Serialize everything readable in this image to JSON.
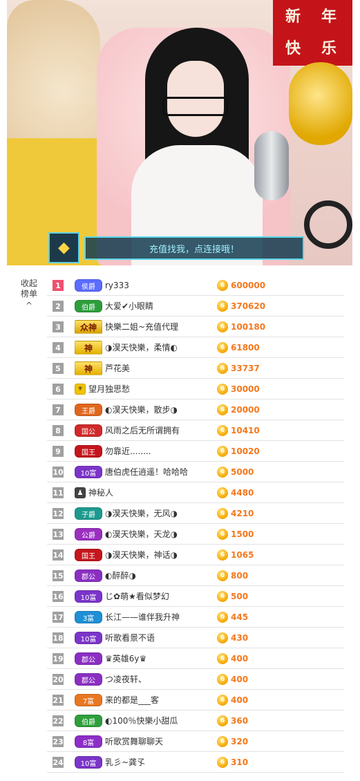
{
  "banner": {
    "gem_icon": "diamond-icon",
    "text": "充值找我，点连接哦！"
  },
  "stream_decor": {
    "red_sign": [
      "新",
      "年",
      "快",
      "乐"
    ]
  },
  "sidebar": {
    "line1": "收起",
    "line2": "榜单",
    "caret": "^"
  },
  "rankings": [
    {
      "rank": "1",
      "badge": "侯爵",
      "badge_color": "#5b6cff",
      "name": "ry333",
      "coin": "6",
      "amount": "600000",
      "rank_color": "#f0506e"
    },
    {
      "rank": "2",
      "badge": "伯爵",
      "badge_color": "#2e9e3c",
      "name": "大爱✔小眼睛",
      "coin": "6",
      "amount": "370620",
      "rank_color": "#a0a0a0"
    },
    {
      "rank": "3",
      "badge": "众神",
      "badge_color": "#d6a300",
      "name": "快樂二姐~充值代理",
      "coin": "6",
      "amount": "100180",
      "rank_color": "#a0a0a0",
      "god": true
    },
    {
      "rank": "4",
      "badge": "神",
      "badge_color": "#e2b100",
      "name": "◑淏天快樂，柔情◐",
      "coin": "6",
      "amount": "61800",
      "rank_color": "#a0a0a0",
      "god": true
    },
    {
      "rank": "5",
      "badge": "神",
      "badge_color": "#e2b100",
      "name": "芦花美",
      "coin": "6",
      "amount": "33737",
      "rank_color": "#a0a0a0",
      "god": true
    },
    {
      "rank": "6",
      "badge": "",
      "badge_color": "#f2c300",
      "name": "望月独思愁",
      "coin": "6",
      "amount": "30000",
      "rank_color": "#a0a0a0",
      "mini": true
    },
    {
      "rank": "7",
      "badge": "王爵",
      "badge_color": "#e0661d",
      "name": "◐淏天快樂，散步◑",
      "coin": "6",
      "amount": "20000",
      "rank_color": "#a0a0a0"
    },
    {
      "rank": "8",
      "badge": "国公",
      "badge_color": "#d02a2a",
      "name": "风雨之后无所谓拥有",
      "coin": "6",
      "amount": "10410",
      "rank_color": "#a0a0a0"
    },
    {
      "rank": "9",
      "badge": "国王",
      "badge_color": "#c4161c",
      "name": "勿靠近........",
      "coin": "6",
      "amount": "10020",
      "rank_color": "#a0a0a0"
    },
    {
      "rank": "10",
      "badge": "10富",
      "badge_color": "#7b35c9",
      "name": "唐伯虎任逍遥！哈哈哈",
      "coin": "6",
      "amount": "5000",
      "rank_color": "#a0a0a0"
    },
    {
      "rank": "11",
      "badge": "",
      "badge_color": "#444444",
      "name": "神秘人",
      "coin": "6",
      "amount": "4480",
      "rank_color": "#a0a0a0",
      "mystery": true
    },
    {
      "rank": "12",
      "badge": "子爵",
      "badge_color": "#1c9a8f",
      "name": "◑淏天快樂，无风◑",
      "coin": "6",
      "amount": "4210",
      "rank_color": "#a0a0a0"
    },
    {
      "rank": "13",
      "badge": "公爵",
      "badge_color": "#9a2fc0",
      "name": "◐淏天快樂，天龙◑",
      "coin": "6",
      "amount": "1500",
      "rank_color": "#a0a0a0"
    },
    {
      "rank": "14",
      "badge": "国王",
      "badge_color": "#c4161c",
      "name": "◑淏天快樂，神话◑",
      "coin": "6",
      "amount": "1065",
      "rank_color": "#a0a0a0"
    },
    {
      "rank": "15",
      "badge": "郡公",
      "badge_color": "#8b2fc2",
      "name": "◐醉醉◑",
      "coin": "6",
      "amount": "800",
      "rank_color": "#a0a0a0"
    },
    {
      "rank": "16",
      "badge": "10富",
      "badge_color": "#7b35c9",
      "name": "じ✿萌★看似梦幻",
      "coin": "6",
      "amount": "500",
      "rank_color": "#a0a0a0"
    },
    {
      "rank": "17",
      "badge": "3富",
      "badge_color": "#1f8fd6",
      "name": "长江——谁伴我升神",
      "coin": "6",
      "amount": "445",
      "rank_color": "#a0a0a0"
    },
    {
      "rank": "18",
      "badge": "10富",
      "badge_color": "#7b35c9",
      "name": "听歌看景不语",
      "coin": "6",
      "amount": "430",
      "rank_color": "#a0a0a0"
    },
    {
      "rank": "19",
      "badge": "郡公",
      "badge_color": "#8b2fc2",
      "name": "♛英雄6y♛",
      "coin": "6",
      "amount": "400",
      "rank_color": "#a0a0a0"
    },
    {
      "rank": "20",
      "badge": "郡公",
      "badge_color": "#8b2fc2",
      "name": "つ凌夜轩、",
      "coin": "6",
      "amount": "400",
      "rank_color": "#a0a0a0"
    },
    {
      "rank": "21",
      "badge": "7富",
      "badge_color": "#e87722",
      "name": "来的都是___客",
      "coin": "6",
      "amount": "400",
      "rank_color": "#a0a0a0"
    },
    {
      "rank": "22",
      "badge": "伯爵",
      "badge_color": "#2e9e3c",
      "name": "◐100％快樂小甜瓜",
      "coin": "6",
      "amount": "360",
      "rank_color": "#a0a0a0"
    },
    {
      "rank": "23",
      "badge": "8富",
      "badge_color": "#8d2ec7",
      "name": "听歌赏舞聊聊天",
      "coin": "6",
      "amount": "320",
      "rank_color": "#a0a0a0"
    },
    {
      "rank": "24",
      "badge": "10富",
      "badge_color": "#7b35c9",
      "name": "乳彡~龚孓",
      "coin": "6",
      "amount": "310",
      "rank_color": "#a0a0a0"
    }
  ]
}
